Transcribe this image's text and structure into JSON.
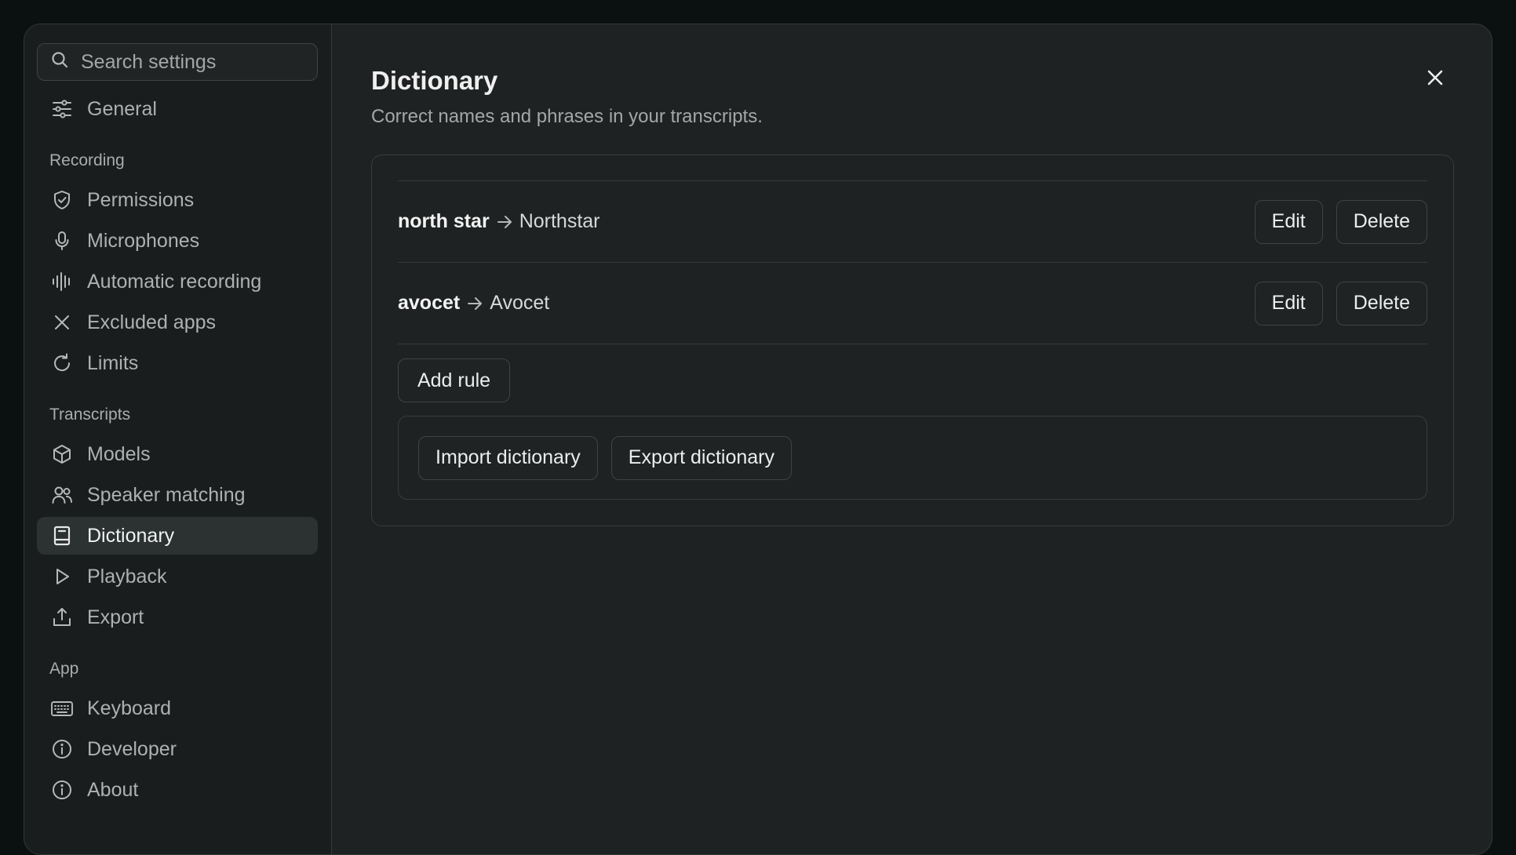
{
  "search": {
    "placeholder": "Search settings"
  },
  "sidebar": {
    "general": {
      "label": "General",
      "icon": "sliders-icon"
    },
    "sections": [
      {
        "label": "Recording",
        "items": [
          {
            "label": "Permissions",
            "icon": "shield-check-icon"
          },
          {
            "label": "Microphones",
            "icon": "microphone-icon"
          },
          {
            "label": "Automatic recording",
            "icon": "waveform-icon"
          },
          {
            "label": "Excluded apps",
            "icon": "x-icon"
          },
          {
            "label": "Limits",
            "icon": "refresh-icon"
          }
        ]
      },
      {
        "label": "Transcripts",
        "items": [
          {
            "label": "Models",
            "icon": "cube-icon"
          },
          {
            "label": "Speaker matching",
            "icon": "users-icon"
          },
          {
            "label": "Dictionary",
            "icon": "book-icon",
            "active": true
          },
          {
            "label": "Playback",
            "icon": "play-icon"
          },
          {
            "label": "Export",
            "icon": "share-icon"
          }
        ]
      },
      {
        "label": "App",
        "items": [
          {
            "label": "Keyboard",
            "icon": "keyboard-icon"
          },
          {
            "label": "Developer",
            "icon": "info-icon"
          },
          {
            "label": "About",
            "icon": "info-icon"
          }
        ]
      }
    ]
  },
  "main": {
    "title": "Dictionary",
    "subtitle": "Correct names and phrases in your transcripts.",
    "rules": [
      {
        "from": "north star",
        "to": "Northstar",
        "edit_label": "Edit",
        "delete_label": "Delete"
      },
      {
        "from": "avocet",
        "to": "Avocet",
        "edit_label": "Edit",
        "delete_label": "Delete"
      }
    ],
    "add_rule_label": "Add rule",
    "import_label": "Import dictionary",
    "export_label": "Export dictionary"
  },
  "colors": {
    "background": "#0b1011",
    "window": "#1f2222",
    "sidebar": "#1a1d1d",
    "active_item": "#2c3131",
    "text": "#e6e7e6",
    "muted_text": "#a3a8a7"
  }
}
